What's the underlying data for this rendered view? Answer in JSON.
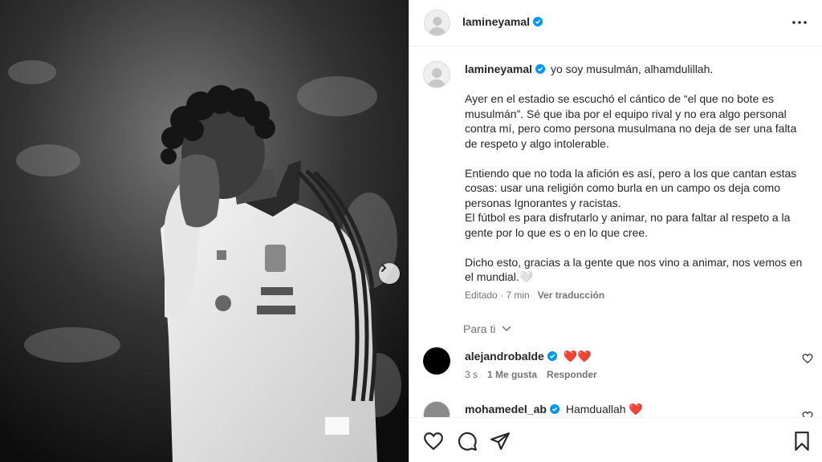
{
  "post": {
    "photo_alt": "",
    "next_icon": "chevron-right-icon"
  },
  "header": {
    "username": "lamineyamal",
    "verified_icon": "verified-badge-icon",
    "more_icon": "more-options-icon"
  },
  "caption": {
    "username": "lamineyamal",
    "first_line": "yo soy musulmán, alhamdulillah.",
    "paragraphs": [
      "Ayer en el estadio se escuchó el cántico de “el que no bote es musulmán”. Sé que iba por el equipo rival y no era algo personal contra mí, pero como persona musulmana no deja de ser una falta de respeto y algo intolerable.",
      "Entiendo que no toda la afición es así, pero a los que cantan estas cosas: usar una religión como burla en un campo os deja como personas Ignorantes y racistas.\nEl fútbol es para disfrutarlo y animar, no para faltar al respeto a la gente por lo que es o en lo que cree.",
      "Dicho esto, gracias a la gente que nos vino a animar, nos vemos en el mundial.🤍"
    ],
    "edited": "Editado · 7 min",
    "translate": "Ver traducción"
  },
  "for_you": "Para ti",
  "comments": [
    {
      "username": "alejandrobalde",
      "text": "❤️❤️",
      "time": "3 s",
      "likes": "1 Me gusta",
      "reply": "Responder"
    },
    {
      "username": "mohamedel_ab",
      "text": "Hamduallah ❤️"
    }
  ],
  "actions": {
    "like_icon": "heart-icon",
    "comment_icon": "comment-icon",
    "share_icon": "share-icon",
    "save_icon": "bookmark-icon"
  },
  "colors": {
    "verified": "#0095f6",
    "heart": "#ed4956",
    "text": "#262626",
    "muted": "#737373"
  }
}
